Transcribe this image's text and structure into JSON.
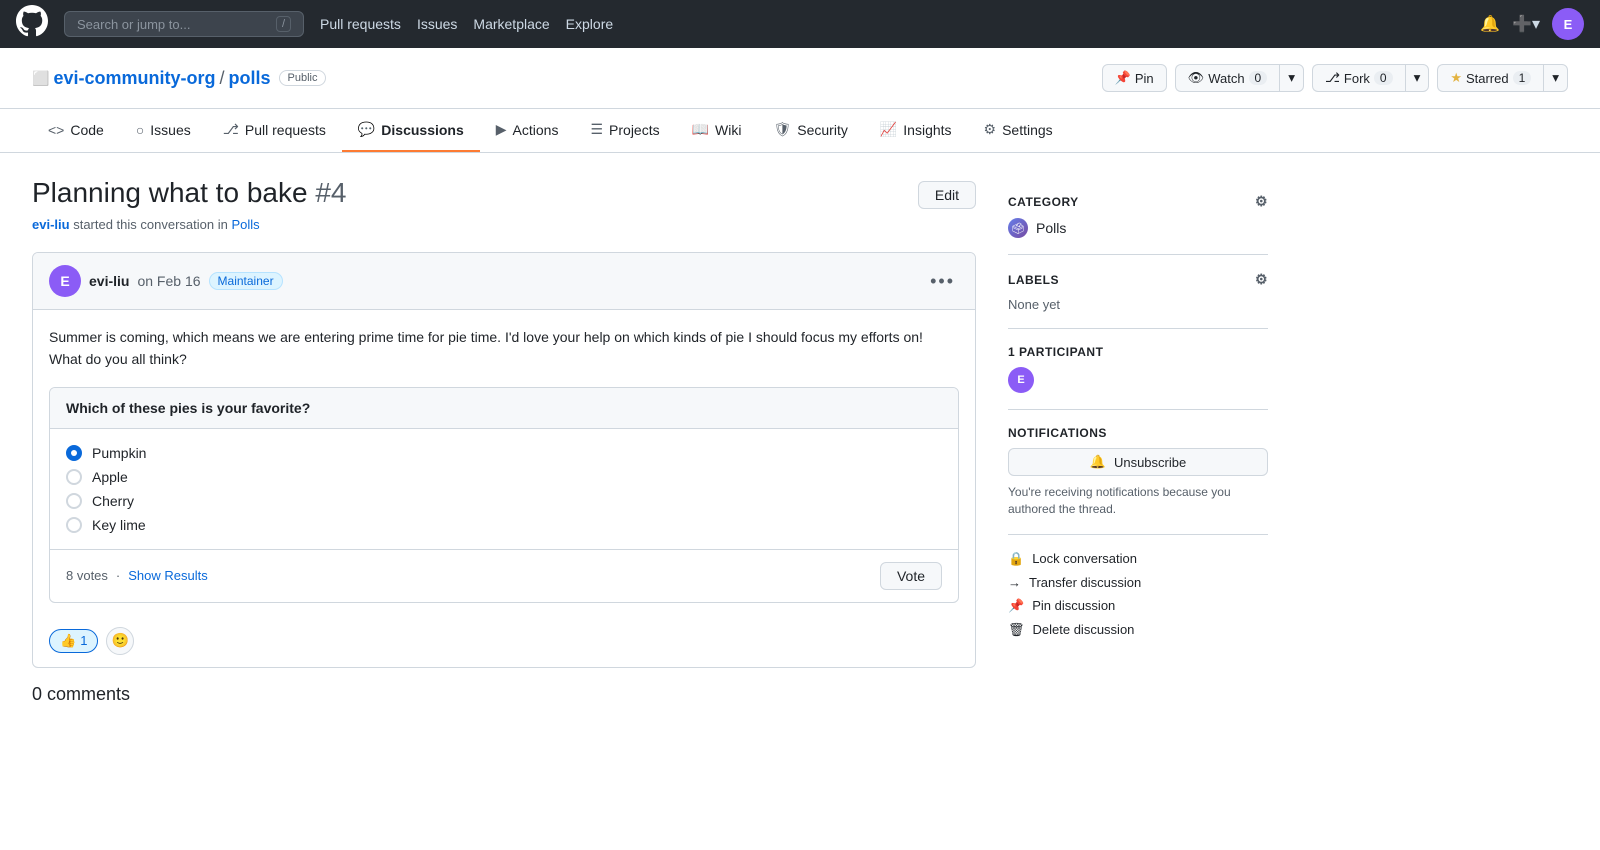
{
  "topnav": {
    "search_placeholder": "Search or jump to...",
    "search_shortcut": "/",
    "links": [
      "Pull requests",
      "Issues",
      "Marketplace",
      "Explore"
    ],
    "logo": "⬤"
  },
  "repo": {
    "org": "evi-community-org",
    "name": "polls",
    "visibility": "Public",
    "pin_label": "Pin",
    "watch_label": "Watch",
    "watch_count": "0",
    "fork_label": "Fork",
    "fork_count": "0",
    "star_label": "Starred",
    "star_count": "1"
  },
  "tabs": [
    {
      "id": "code",
      "label": "Code",
      "icon": "<>"
    },
    {
      "id": "issues",
      "label": "Issues",
      "icon": "○"
    },
    {
      "id": "pull-requests",
      "label": "Pull requests",
      "icon": "⎇"
    },
    {
      "id": "discussions",
      "label": "Discussions",
      "icon": "💬",
      "active": true
    },
    {
      "id": "actions",
      "label": "Actions",
      "icon": "▶"
    },
    {
      "id": "projects",
      "label": "Projects",
      "icon": "☰"
    },
    {
      "id": "wiki",
      "label": "Wiki",
      "icon": "📖"
    },
    {
      "id": "security",
      "label": "Security",
      "icon": "🛡"
    },
    {
      "id": "insights",
      "label": "Insights",
      "icon": "📈"
    },
    {
      "id": "settings",
      "label": "Settings",
      "icon": "⚙"
    }
  ],
  "discussion": {
    "title": "Planning what to bake",
    "number": "#4",
    "author": "evi-liu",
    "started_text": "started this conversation in",
    "category": "Polls",
    "post": {
      "author": "evi-liu",
      "date": "on Feb 16",
      "badge": "Maintainer",
      "body": "Summer is coming, which means we are entering prime time for pie time. I'd love your help on which kinds of pie I should focus my efforts on! What do you all think?"
    },
    "poll": {
      "question": "Which of these pies is your favorite?",
      "options": [
        {
          "label": "Pumpkin",
          "selected": true
        },
        {
          "label": "Apple",
          "selected": false
        },
        {
          "label": "Cherry",
          "selected": false
        },
        {
          "label": "Key lime",
          "selected": false
        }
      ],
      "votes": "8 votes",
      "show_results_label": "Show Results",
      "vote_btn_label": "Vote"
    },
    "reaction_count": "1",
    "comments_count": "0 comments"
  },
  "sidebar": {
    "category_label": "Category",
    "category_name": "Polls",
    "labels_label": "Labels",
    "labels_none": "None yet",
    "participants_label": "1 participant",
    "notifications_label": "Notifications",
    "unsubscribe_label": "Unsubscribe",
    "notification_reason": "You're receiving notifications because you authored the thread.",
    "actions": [
      {
        "id": "lock",
        "label": "Lock conversation",
        "icon": "🔒"
      },
      {
        "id": "transfer",
        "label": "Transfer discussion",
        "icon": "→"
      },
      {
        "id": "pin",
        "label": "Pin discussion",
        "icon": "📌"
      },
      {
        "id": "delete",
        "label": "Delete discussion",
        "icon": "🗑"
      }
    ]
  }
}
